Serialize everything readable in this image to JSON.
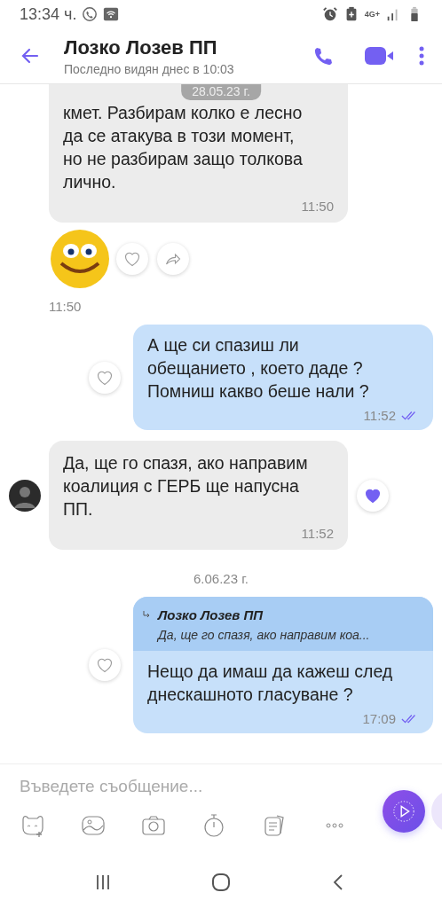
{
  "status_bar": {
    "time": "13:34 ч.",
    "network": "4G+"
  },
  "header": {
    "title": "Лозко Лозев ПП",
    "subtitle": "Последно видян днес в 10:03"
  },
  "date_overlay": "28.05.23 г.",
  "messages": [
    {
      "kind": "incoming",
      "cut": true,
      "avatar": false,
      "lines": [
        "кмет. Разбирам колко е лесно",
        "да се атакува в този момент,",
        "но не разбирам защо толкова",
        "лично."
      ],
      "time": "11:50"
    },
    {
      "kind": "sticker",
      "liked": false,
      "time": "11:50"
    },
    {
      "kind": "outgoing",
      "lines": [
        "А ще си спазиш ли",
        "обещанието , което даде ?",
        "Помниш какво беше нали ?"
      ],
      "time": "11:52",
      "read": true,
      "liked": false
    },
    {
      "kind": "incoming",
      "cut": false,
      "avatar": true,
      "lines": [
        "Да, ще го спазя, ако направим",
        "коалиция с ГЕРБ ще напусна",
        "ПП."
      ],
      "time": "11:52",
      "liked": true
    },
    {
      "kind": "date",
      "text": "6.06.23 г."
    },
    {
      "kind": "outgoing",
      "reply": {
        "name": "Лозко Лозев ПП",
        "text": "Да, ще го спазя, ако направим коа..."
      },
      "lines": [
        "Нещо да имаш да кажеш след",
        "днескашното гласуване ?"
      ],
      "time": "17:09",
      "read": true,
      "liked": false
    }
  ],
  "composer": {
    "placeholder": "Въведете съобщение..."
  }
}
